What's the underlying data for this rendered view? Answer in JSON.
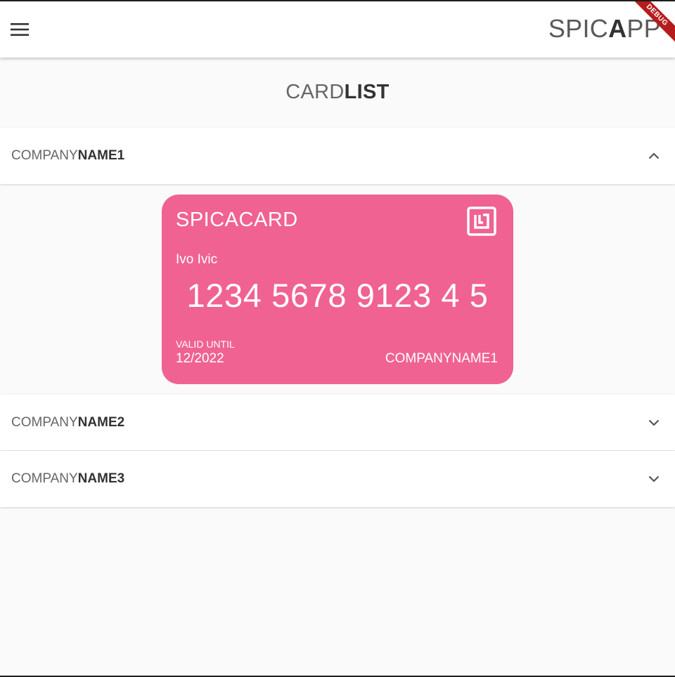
{
  "appbar": {
    "title_light": "SPIC",
    "title_bold": "A",
    "title_tail": "PP",
    "menu_icon": "hamburger-menu-icon",
    "debug_banner": "DEBUG"
  },
  "page": {
    "title_light": "CARD",
    "title_bold": "LIST"
  },
  "panels": [
    {
      "prefix": "COMPANY",
      "suffix": "NAME1",
      "state": "expanded",
      "icon": "chevron-up-icon"
    },
    {
      "prefix": "COMPANY",
      "suffix": "NAME2",
      "state": "collapsed",
      "icon": "chevron-down-icon"
    },
    {
      "prefix": "COMPANY",
      "suffix": "NAME3",
      "state": "collapsed",
      "icon": "chevron-down-icon"
    }
  ],
  "card": {
    "brand": "SPICACARD",
    "nfc_icon": "nfc-icon",
    "holder": "Ivo Ivic",
    "number": "1234 5678 9123 4 5",
    "valid_label": "VALID UNTIL",
    "valid_value": "12/2022",
    "company": "COMPANYNAME1",
    "color": "#f06292"
  },
  "colors": {
    "background": "#fafafa",
    "appbar": "#ffffff",
    "debug_ribbon": "#b71c1c"
  }
}
